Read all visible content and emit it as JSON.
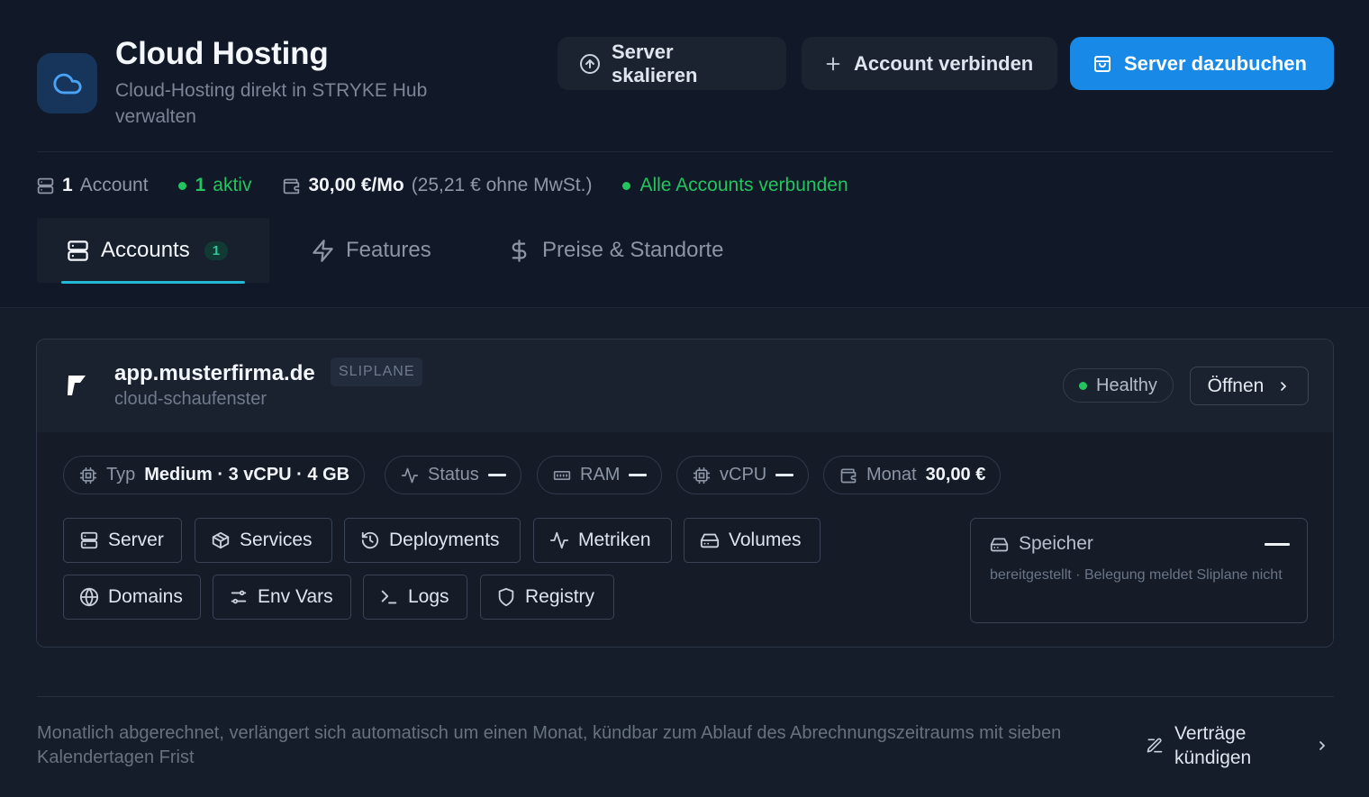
{
  "header": {
    "title": "Cloud Hosting",
    "subtitle": "Cloud-Hosting direkt in STRYKE Hub verwalten",
    "buttons": {
      "scale": "Server skalieren",
      "connect": "Account verbinden",
      "book": "Server dazubuchen"
    }
  },
  "stats": {
    "account_count": "1",
    "account_label": "Account",
    "active_count": "1",
    "active_label": "aktiv",
    "price": "30,00 €/Mo",
    "price_net": "(25,21 € ohne MwSt.)",
    "connection_status": "Alle Accounts verbunden"
  },
  "tabs": [
    {
      "label": "Accounts",
      "badge": "1"
    },
    {
      "label": "Features"
    },
    {
      "label": "Preise & Standorte"
    }
  ],
  "account": {
    "domain": "app.musterfirma.de",
    "provider_tag": "SLIPLANE",
    "project": "cloud-schaufenster",
    "health": "Healthy",
    "open_label": "Öffnen",
    "pills": {
      "type_label": "Typ",
      "type_value": "Medium · 3 vCPU · 4 GB",
      "status_label": "Status",
      "ram_label": "RAM",
      "vcpu_label": "vCPU",
      "month_label": "Monat",
      "month_value": "30,00 €"
    },
    "actions": [
      "Server",
      "Services",
      "Deployments",
      "Metriken",
      "Volumes",
      "Domains",
      "Env Vars",
      "Logs",
      "Registry"
    ],
    "storage": {
      "label": "Speicher",
      "description": "bereitgestellt · Belegung meldet Sliplane nicht"
    }
  },
  "footer": {
    "billing_note": "Monatlich abgerechnet, verlängert sich automatisch um einen Monat, kündbar zum Ablauf des Abrechnungszeitraums mit sieben Kalendertagen Frist",
    "cancel_label": "Verträge kündigen"
  },
  "colors": {
    "accent": "#1889e6",
    "success": "#22c55e",
    "tab_underline": "#22b8d6"
  }
}
